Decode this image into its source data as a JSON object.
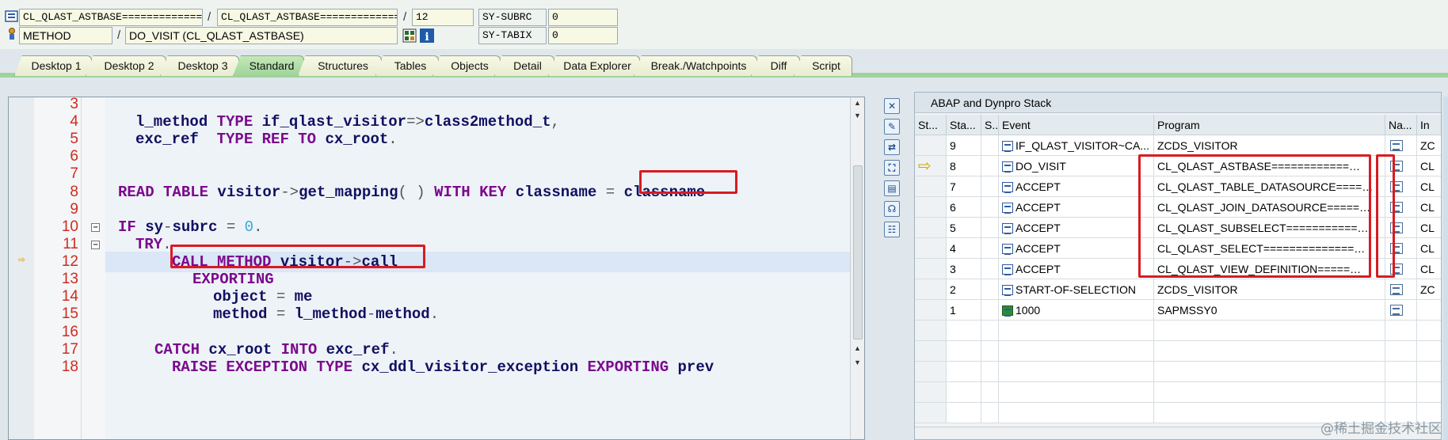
{
  "header": {
    "row1": {
      "field1": "CL_QLAST_ASTBASE=============…",
      "sep1": "/",
      "field2": "CL_QLAST_ASTBASE=============…",
      "sep2": "/",
      "field3": "12",
      "label": "SY-SUBRC",
      "value": "0"
    },
    "row2": {
      "field1": "METHOD",
      "sep1": "/",
      "field2": "DO_VISIT (CL_QLAST_ASTBASE)",
      "label": "SY-TABIX",
      "value": "0"
    }
  },
  "tabs": [
    {
      "label": "Desktop 1"
    },
    {
      "label": "Desktop 2"
    },
    {
      "label": "Desktop 3"
    },
    {
      "label": "Standard",
      "active": true
    },
    {
      "label": "Structures"
    },
    {
      "label": "Tables"
    },
    {
      "label": "Objects"
    },
    {
      "label": "Detail"
    },
    {
      "label": "Data Explorer"
    },
    {
      "label": "Break./Watchpoints"
    },
    {
      "label": "Diff"
    },
    {
      "label": "Script"
    }
  ],
  "editor": {
    "lines": [
      {
        "n": "3"
      },
      {
        "n": "4"
      },
      {
        "n": "5"
      },
      {
        "n": "6"
      },
      {
        "n": "7"
      },
      {
        "n": "8"
      },
      {
        "n": "9"
      },
      {
        "n": "10"
      },
      {
        "n": "11"
      },
      {
        "n": "12"
      },
      {
        "n": "13"
      },
      {
        "n": "14"
      },
      {
        "n": "15"
      },
      {
        "n": "16"
      },
      {
        "n": "17"
      },
      {
        "n": "18"
      }
    ],
    "code": {
      "l4": [
        "l_method ",
        "TYPE ",
        "if_qlast_visitor",
        "=>",
        "class2method_t",
        ","
      ],
      "l5": [
        "exc_ref  ",
        "TYPE REF TO ",
        "cx_root",
        "."
      ],
      "l8": [
        "READ TABLE ",
        "visitor",
        "->",
        "get_mapping",
        "( ) ",
        "WITH KEY ",
        "classname ",
        "= ",
        "classname"
      ],
      "l10": [
        "IF ",
        "sy",
        "-",
        "subrc ",
        "= ",
        "0",
        "."
      ],
      "l11": [
        "TRY",
        "."
      ],
      "l12": [
        "CALL METHOD ",
        "visitor",
        "->",
        "call"
      ],
      "l13": [
        "EXPORTING"
      ],
      "l14": [
        "object ",
        "= ",
        "me"
      ],
      "l15": [
        "method ",
        "= ",
        "l_method",
        "-",
        "method",
        "."
      ],
      "l17": [
        "CATCH ",
        "cx_root ",
        "INTO ",
        "exc_ref",
        "."
      ],
      "l18": [
        "RAISE EXCEPTION TYPE ",
        "cx_ddl_visitor_exception ",
        "EXPORTING ",
        "prev"
      ]
    }
  },
  "stack": {
    "title": "ABAP and Dynpro Stack",
    "columns": [
      "St...",
      "Sta...",
      "S..",
      "Event",
      "Program",
      "Na...",
      "In"
    ],
    "rows": [
      {
        "level": "9",
        "event": "IF_QLAST_VISITOR~CA...",
        "program": "ZCDS_VISITOR",
        "include": "ZC"
      },
      {
        "level": "8",
        "event": "DO_VISIT",
        "program": "CL_QLAST_ASTBASE============…",
        "include": "CL",
        "current": true
      },
      {
        "level": "7",
        "event": "ACCEPT",
        "program": "CL_QLAST_TABLE_DATASOURCE====…",
        "include": "CL"
      },
      {
        "level": "6",
        "event": "ACCEPT",
        "program": "CL_QLAST_JOIN_DATASOURCE=====…",
        "include": "CL"
      },
      {
        "level": "5",
        "event": "ACCEPT",
        "program": "CL_QLAST_SUBSELECT===========…",
        "include": "CL"
      },
      {
        "level": "4",
        "event": "ACCEPT",
        "program": "CL_QLAST_SELECT==============…",
        "include": "CL"
      },
      {
        "level": "3",
        "event": "ACCEPT",
        "program": "CL_QLAST_VIEW_DEFINITION=====…",
        "include": "CL"
      },
      {
        "level": "2",
        "event": "START-OF-SELECTION",
        "program": "ZCDS_VISITOR",
        "include": "ZC"
      },
      {
        "level": "1",
        "event": "1000",
        "program": "SAPMSSY0",
        "include": ""
      }
    ]
  },
  "watermark": "@稀土掘金技术社区"
}
